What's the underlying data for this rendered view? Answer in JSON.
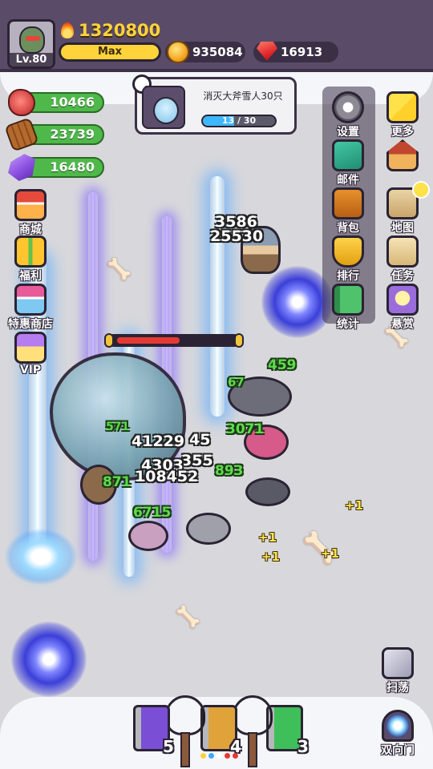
{
  "player": {
    "level": "Lv.80",
    "power": "1320800",
    "exp_label": "Max"
  },
  "currencies": {
    "gold": "935084",
    "gems": "16913"
  },
  "resources": {
    "meat": "10466",
    "wood": "23739",
    "ore": "16480"
  },
  "quest": {
    "title": "消灭大斧雪人30只",
    "progress_text": "13 / 30",
    "progress": 0.4333
  },
  "left_menu": [
    {
      "label": "商城"
    },
    {
      "label": "福利"
    },
    {
      "label": "特惠商店"
    },
    {
      "label": "VIP"
    }
  ],
  "right_menu": {
    "settings": "设置",
    "more": "更多",
    "mail": "邮件",
    "community": "社区",
    "bag": "背包",
    "map": "地图",
    "rank": "排行",
    "task": "任务",
    "stats": "统计",
    "bounty": "悬赏"
  },
  "bottom_right": {
    "sweep": "扫荡",
    "portal": "双向门"
  },
  "boss_hp": 0.55,
  "damage_numbers": [
    {
      "text": "3586",
      "style": "w"
    },
    {
      "text": "25530",
      "style": "w"
    },
    {
      "text": "459",
      "style": "g"
    },
    {
      "text": "67",
      "style": "g"
    },
    {
      "text": "3071",
      "style": "g"
    },
    {
      "text": "571",
      "style": "g"
    },
    {
      "text": "41229",
      "style": "w"
    },
    {
      "text": "45",
      "style": "w"
    },
    {
      "text": "355",
      "style": "w"
    },
    {
      "text": "4303",
      "style": "w"
    },
    {
      "text": "108452",
      "style": "w"
    },
    {
      "text": "893",
      "style": "g"
    },
    {
      "text": "871",
      "style": "g"
    },
    {
      "text": "6715",
      "style": "g"
    },
    {
      "text": "+1",
      "style": "y"
    },
    {
      "text": "+1",
      "style": "y"
    },
    {
      "text": "+1",
      "style": "y"
    },
    {
      "text": "+1",
      "style": "y"
    }
  ],
  "skills": [
    {
      "count": "5",
      "color": "#7a4fd6"
    },
    {
      "count": "4",
      "color": "#e0a33a"
    },
    {
      "count": "3",
      "color": "#3fbf5a"
    }
  ],
  "colors": {
    "topbar": "#5a4c68",
    "resource_bar": "#4fb84a",
    "power": "#ffd23c",
    "beam": "#bfe6ff"
  }
}
